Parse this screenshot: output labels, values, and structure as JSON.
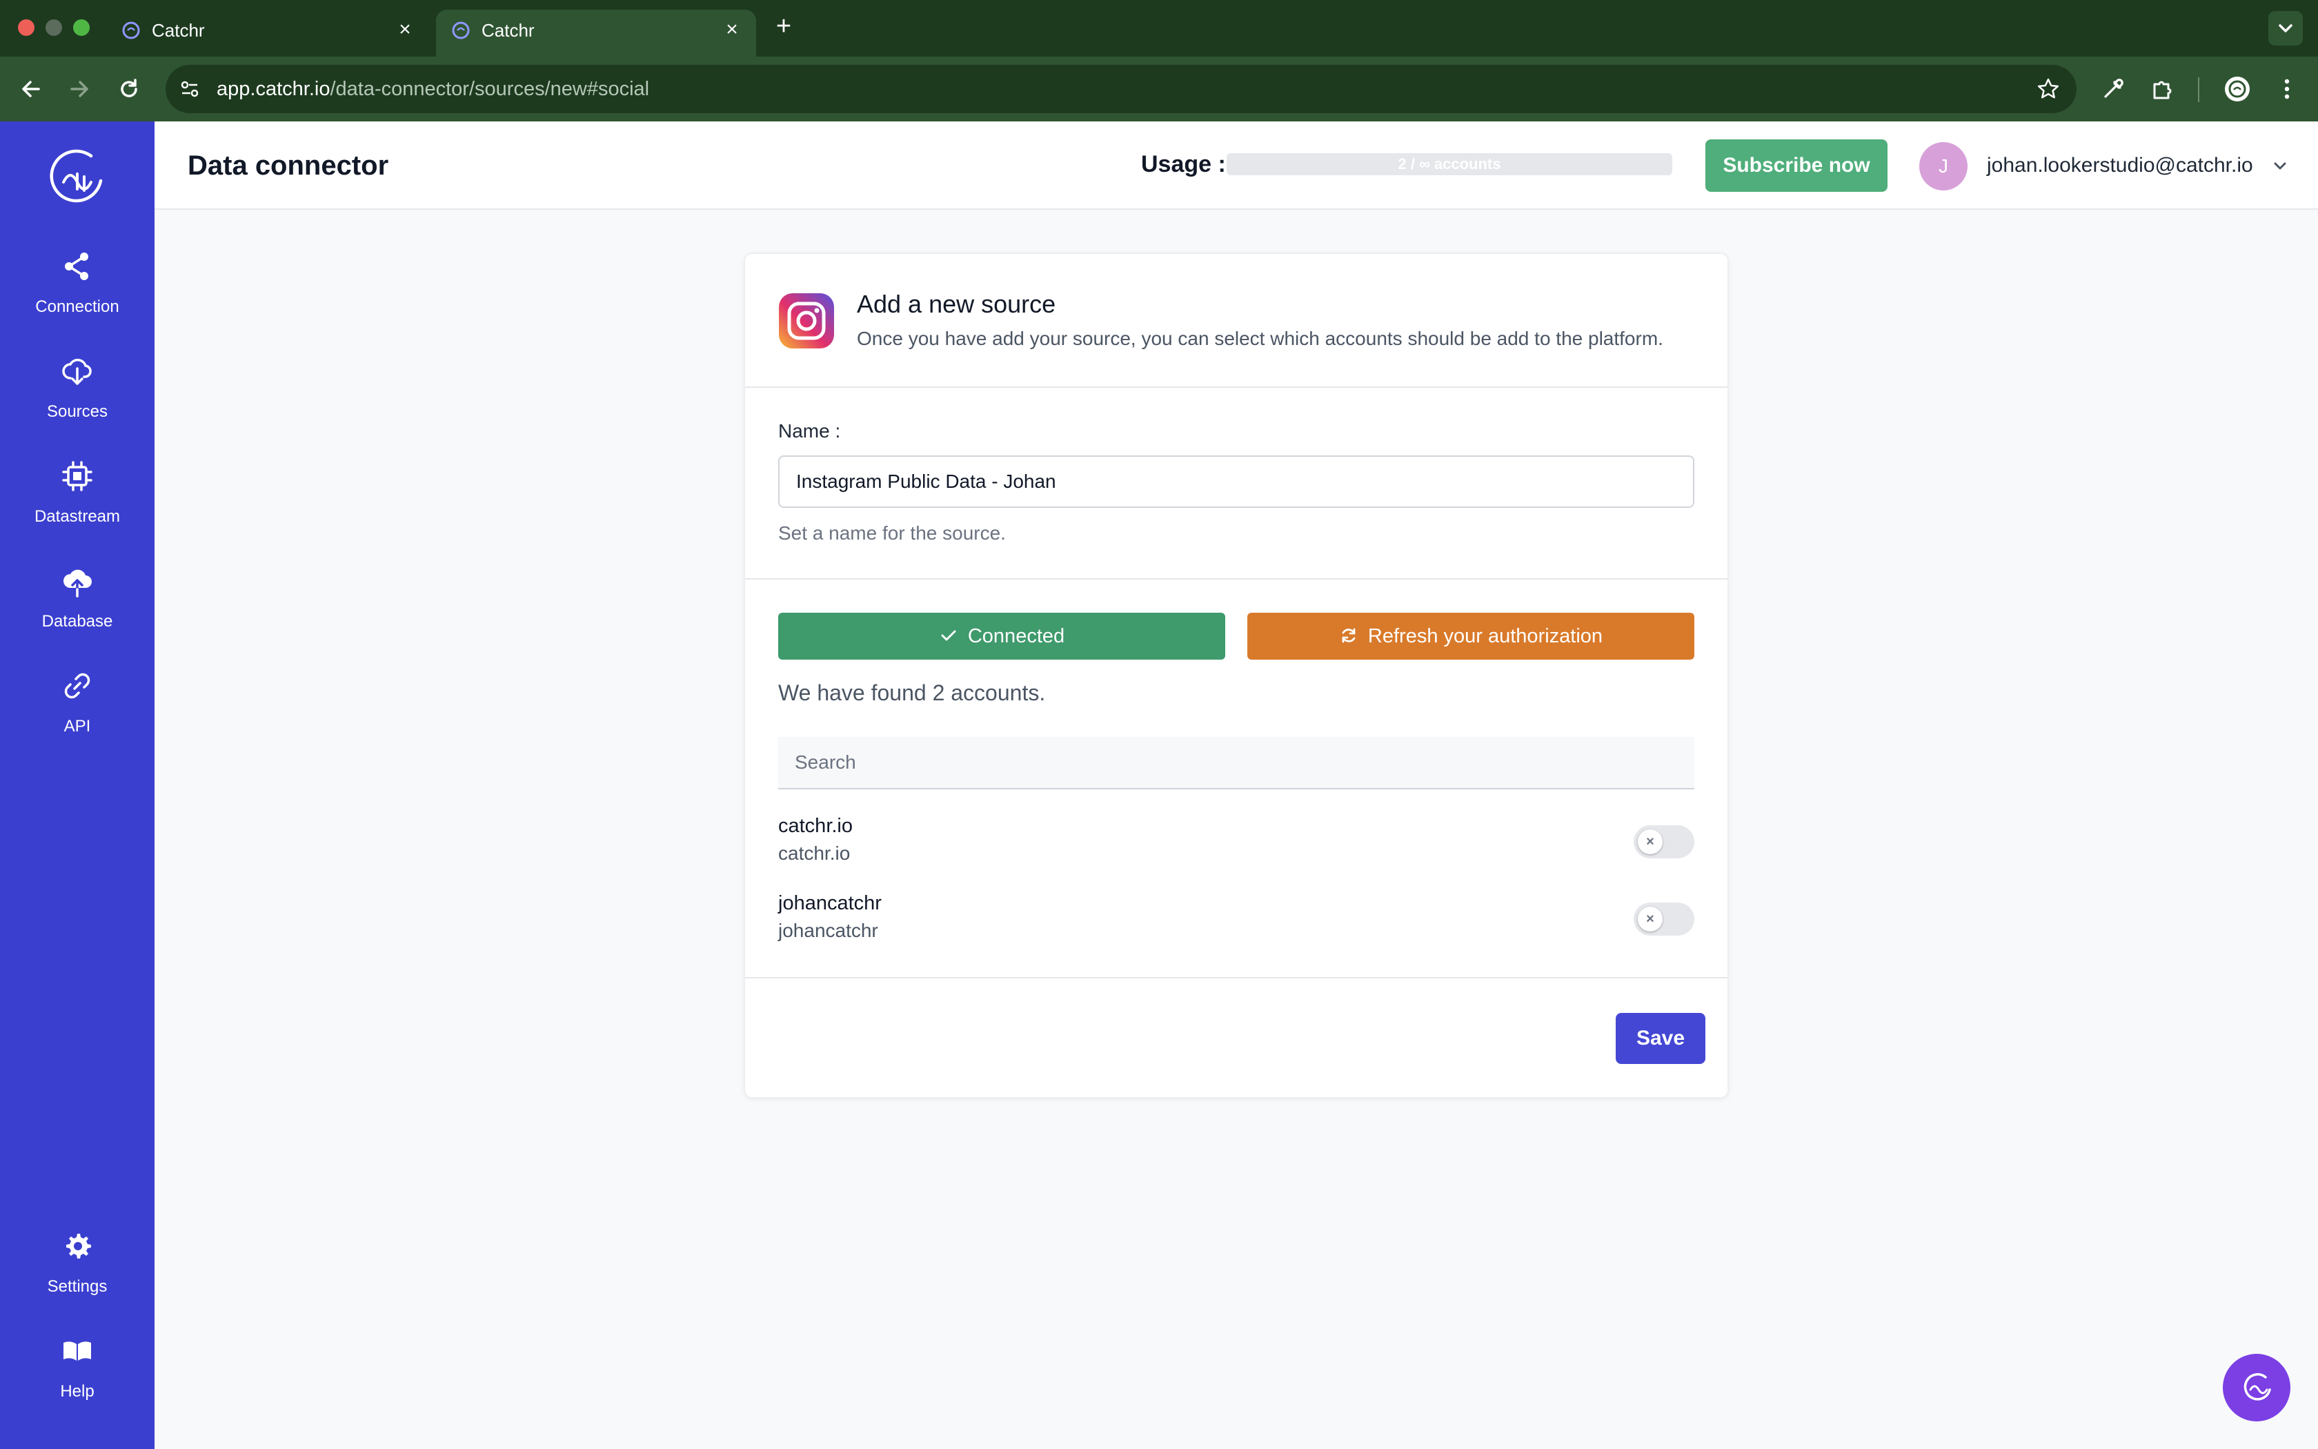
{
  "browser": {
    "tabs": [
      {
        "title": "Catchr",
        "active": false
      },
      {
        "title": "Catchr",
        "active": true
      }
    ],
    "new_tab_icon": "plus-icon",
    "url_host": "app.catchr.io",
    "url_path": "/data-connector/sources/new#social",
    "colors": {
      "frame": "#1d3a1f",
      "toolbar": "#2f5432"
    }
  },
  "sidebar": {
    "color": "#3b3fcf",
    "items": [
      {
        "label": "Connection",
        "icon": "share-icon"
      },
      {
        "label": "Sources",
        "icon": "cloud-download-icon"
      },
      {
        "label": "Datastream",
        "icon": "chip-icon"
      },
      {
        "label": "Database",
        "icon": "cloud-upload-icon"
      },
      {
        "label": "API",
        "icon": "link-icon"
      }
    ],
    "bottom_items": [
      {
        "label": "Settings",
        "icon": "gear-icon"
      },
      {
        "label": "Help",
        "icon": "book-icon"
      }
    ]
  },
  "header": {
    "title": "Data connector",
    "usage_label": "Usage :",
    "usage_text": "2 / ∞ accounts",
    "subscribe_label": "Subscribe now",
    "avatar_initial": "J",
    "user_email": "johan.lookerstudio@catchr.io"
  },
  "card": {
    "title": "Add a new source",
    "description": "Once you have add your source, you can select which accounts should be add to the platform.",
    "name_label": "Name :",
    "name_value": "Instagram Public Data - Johan",
    "name_help": "Set a name for the source.",
    "connected_label": "Connected",
    "refresh_label": "Refresh your authorization",
    "found_text": "We have found 2 accounts.",
    "search_placeholder": "Search",
    "accounts": [
      {
        "name": "catchr.io",
        "sub": "catchr.io",
        "enabled": false
      },
      {
        "name": "johancatchr",
        "sub": "johancatchr",
        "enabled": false
      }
    ],
    "save_label": "Save"
  },
  "colors": {
    "connected": "#3f9a6c",
    "refresh": "#d97a2b",
    "save": "#4447d4",
    "subscribe": "#4fae7b"
  }
}
